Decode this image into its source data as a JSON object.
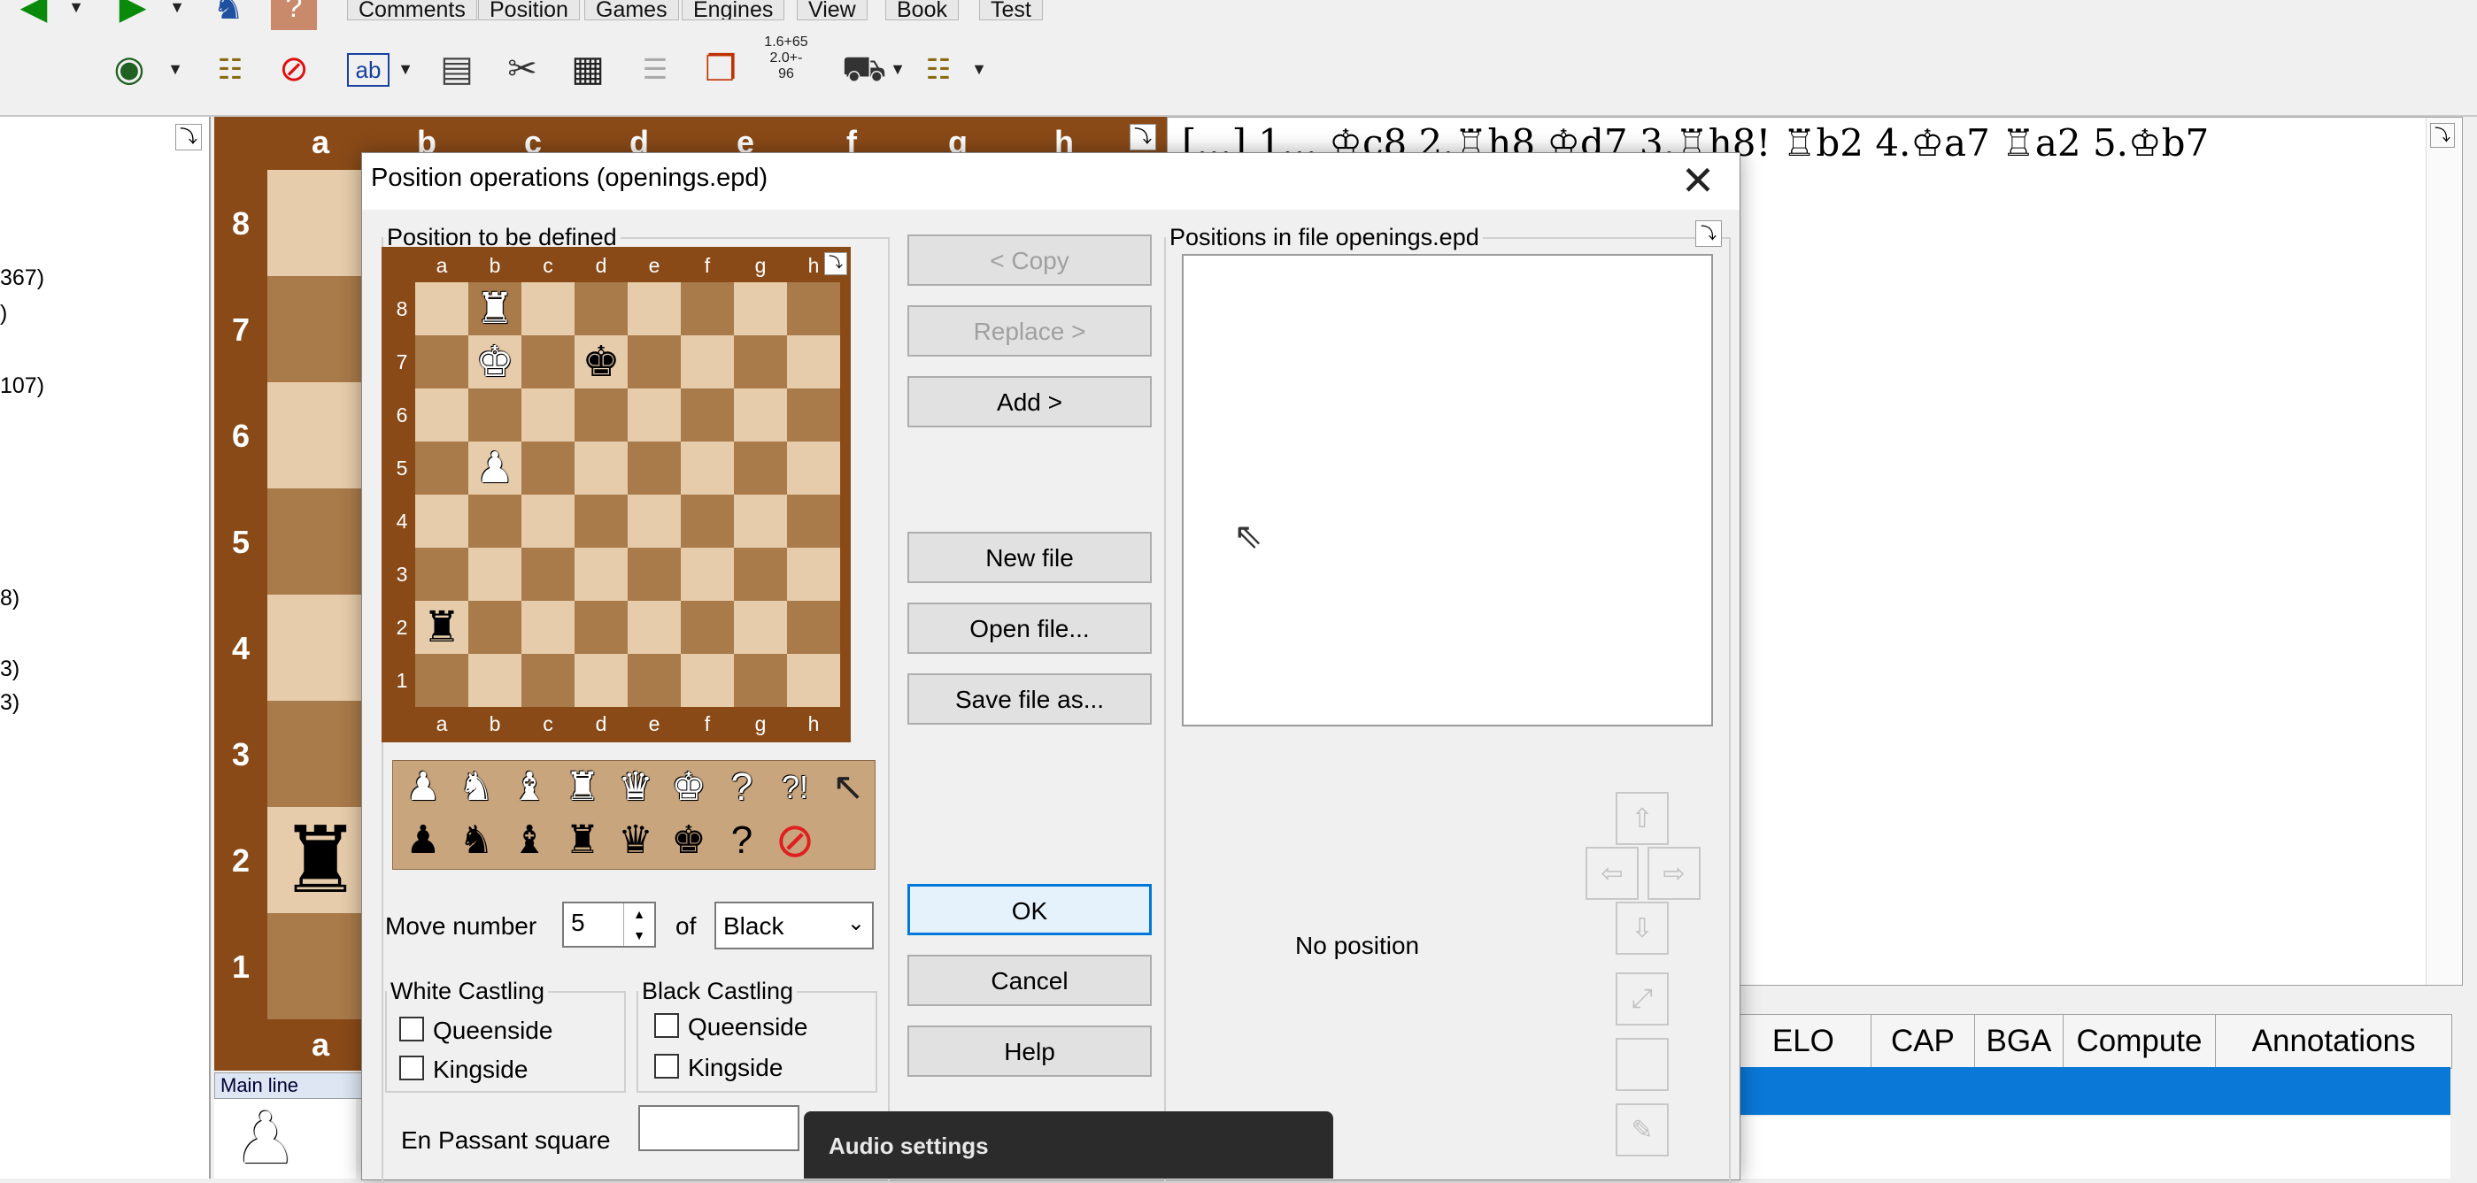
{
  "menu": {
    "tabs": [
      {
        "label": "Comments"
      },
      {
        "label": "Position"
      },
      {
        "label": "Games"
      },
      {
        "label": "Engines"
      },
      {
        "label": "View"
      },
      {
        "label": "Book"
      },
      {
        "label": "Test"
      }
    ]
  },
  "toolbar": {
    "icons": [
      "back-arrow-icon",
      "forward-arrow-icon",
      "players-icon",
      "help-icon",
      "view-icon",
      "tree-icon",
      "forbidden-icon",
      "text-edit-icon",
      "calculator-icon",
      "scissors-icon",
      "chessboard-icon",
      "list-icon",
      "copy-icon",
      "score-icon",
      "camera-icon",
      "tree-options-icon"
    ],
    "score_icon_text": "1.6+65\n2.0+-\n96"
  },
  "left_panel": {
    "lines": [
      "367)",
      ")",
      "107)",
      "8)",
      "3)",
      "3)"
    ]
  },
  "big_board": {
    "files": [
      "a",
      "b",
      "c",
      "d",
      "e",
      "f",
      "g",
      "h"
    ],
    "ranks": [
      "8",
      "7",
      "6",
      "5",
      "4",
      "3",
      "2",
      "1"
    ],
    "piece_a2": "♜",
    "main_line_label": "Main line"
  },
  "notation": {
    "text": "[...] 1... ♔c8 2.♖h8 ♔d7 3.♖h8! ♖b2 4.♔a7 ♖a2 5.♔b7"
  },
  "game_list": {
    "columns": [
      "ELO",
      "CAP",
      "BGA",
      "Compute",
      "Annotations"
    ]
  },
  "dialog": {
    "title": "Position operations (openings.epd)",
    "close_glyph": "✕",
    "position_group_label": "Position to be defined",
    "file_group_label": "Positions in file openings.epd",
    "files": [
      "a",
      "b",
      "c",
      "d",
      "e",
      "f",
      "g",
      "h"
    ],
    "ranks": [
      "8",
      "7",
      "6",
      "5",
      "4",
      "3",
      "2",
      "1"
    ],
    "pieces": [
      {
        "square": "b8",
        "glyph": "♜",
        "color": "white"
      },
      {
        "square": "b7",
        "glyph": "♚",
        "color": "white"
      },
      {
        "square": "d7",
        "glyph": "♚",
        "color": "black"
      },
      {
        "square": "b5",
        "glyph": "♟",
        "color": "white"
      },
      {
        "square": "a2",
        "glyph": "♜",
        "color": "black"
      }
    ],
    "palette_white": [
      "♟",
      "♞",
      "♝",
      "♜",
      "♛",
      "♚",
      "?",
      "?!",
      "↖"
    ],
    "palette_black": [
      "♟",
      "♞",
      "♝",
      "♜",
      "♛",
      "♚",
      "?",
      "⊘"
    ],
    "buttons": {
      "copy": "< Copy",
      "replace": "Replace >",
      "add": "Add >",
      "new_file": "New file",
      "open_file": "Open file...",
      "save_file_as": "Save file as...",
      "ok": "OK",
      "cancel": "Cancel",
      "help": "Help"
    },
    "move_number_label": "Move number",
    "move_number_value": "5",
    "of_label": "of",
    "side_value": "Black",
    "white_castling_label": "White Castling",
    "black_castling_label": "Black Castling",
    "queenside_label": "Queenside",
    "kingside_label": "Kingside",
    "en_passant_label": "En Passant square",
    "en_passant_value": "",
    "no_position_text": "No position"
  },
  "audio_popup": {
    "label": "Audio settings"
  },
  "colors": {
    "board_frame": "#8a4a18",
    "light_square": "#e6ccaa",
    "dark_square": "#a97a4a",
    "selection": "#0a78d7",
    "default_button_border": "#0078d7"
  }
}
